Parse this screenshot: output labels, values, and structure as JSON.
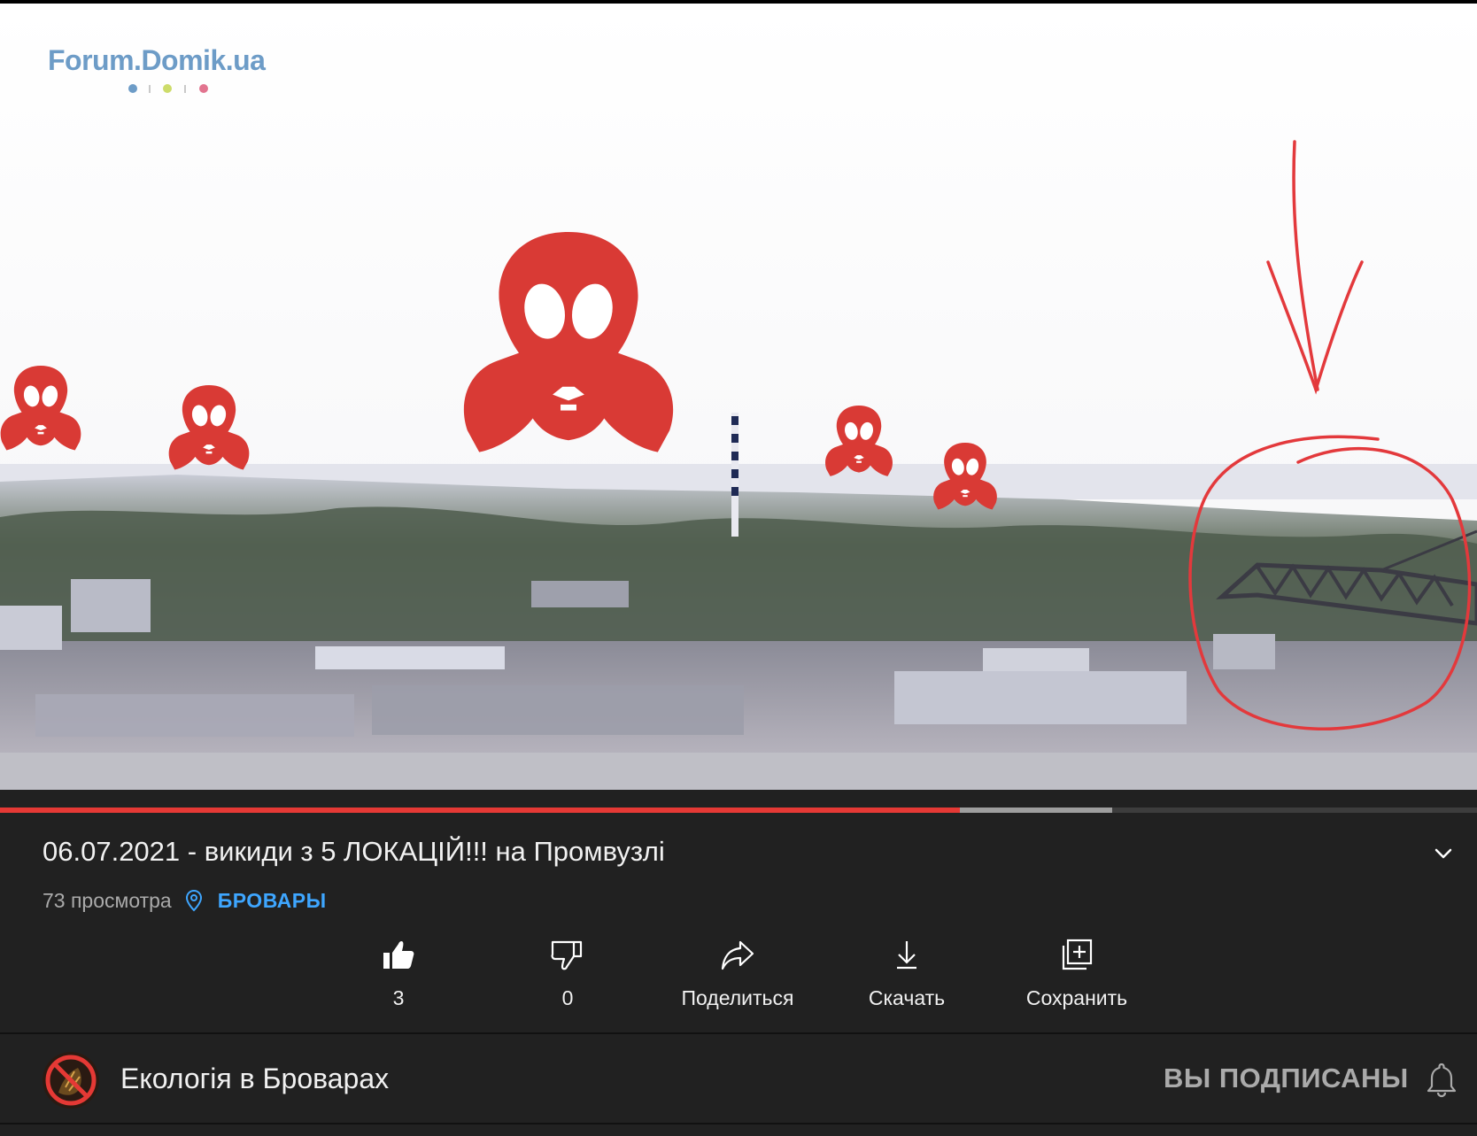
{
  "watermark": {
    "text": "Forum.Domik.ua"
  },
  "player": {
    "played_fraction": 0.65,
    "buffered_fraction": 0.753
  },
  "video": {
    "title": "06.07.2021 - викиди з 5 ЛОКАЦІЙ!!!  на Промвузлі",
    "views": "73 просмотра",
    "location": "БРОВАРЫ"
  },
  "actions": {
    "like_count": "3",
    "dislike_count": "0",
    "share_label": "Поделиться",
    "download_label": "Скачать",
    "save_label": "Сохранить"
  },
  "channel": {
    "name": "Екологія в Броварах",
    "subscribe_state": "ВЫ ПОДПИСАНЫ"
  },
  "icons": {
    "like": "thumbs-up-icon",
    "dislike": "thumbs-down-icon",
    "share": "share-icon",
    "download": "download-icon",
    "save": "add-to-playlist-icon",
    "location": "location-pin-icon",
    "notifications": "bell-icon",
    "expand": "chevron-down-icon"
  },
  "colors": {
    "accent_red": "#e53935",
    "gasmask_red": "#d93a35",
    "link_blue": "#3ea6ff",
    "background": "#212121"
  }
}
